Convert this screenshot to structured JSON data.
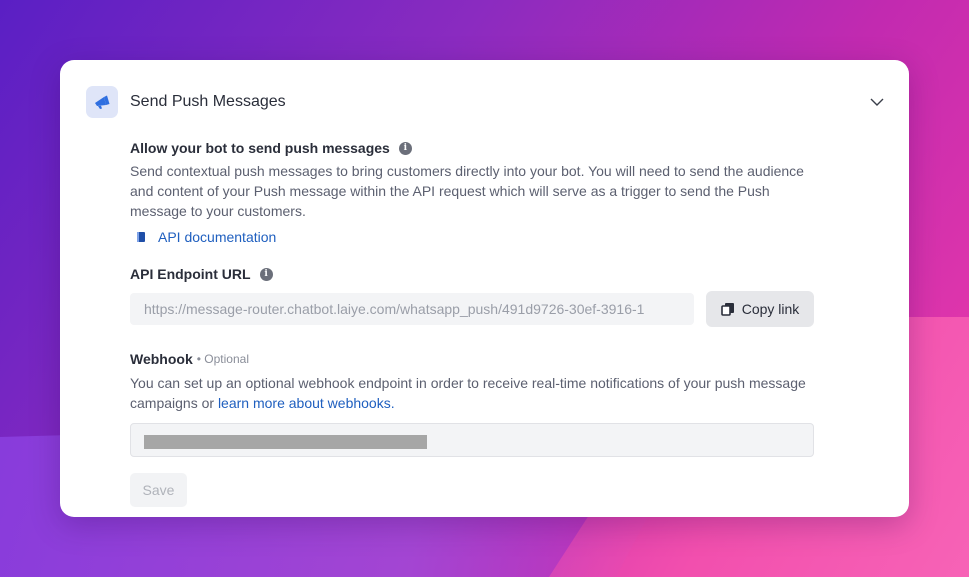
{
  "header": {
    "title": "Send Push Messages",
    "icon": "megaphone-icon",
    "collapse_icon": "chevron-down-icon"
  },
  "push": {
    "title": "Allow your bot to send push messages",
    "description": "Send contextual push messages to bring customers directly into your bot. You will need to send the audience and content of your Push message within the API request which will serve as a trigger to send the Push message to your customers.",
    "doc_link": "API documentation"
  },
  "endpoint": {
    "label": "API Endpoint URL",
    "value": "https://message-router.chatbot.laiye.com/whatsapp_push/491d9726-30ef-3916-1",
    "copy_label": "Copy link"
  },
  "webhook": {
    "label": "Webhook",
    "optional": "• Optional",
    "description": "You can set up an optional webhook endpoint in order to receive real-time notifications of your push message campaigns or ",
    "link": "learn more about webhooks."
  },
  "save_label": "Save",
  "colors": {
    "accent": "#1f5fbf",
    "icon_bg": "#dfe5f8"
  }
}
